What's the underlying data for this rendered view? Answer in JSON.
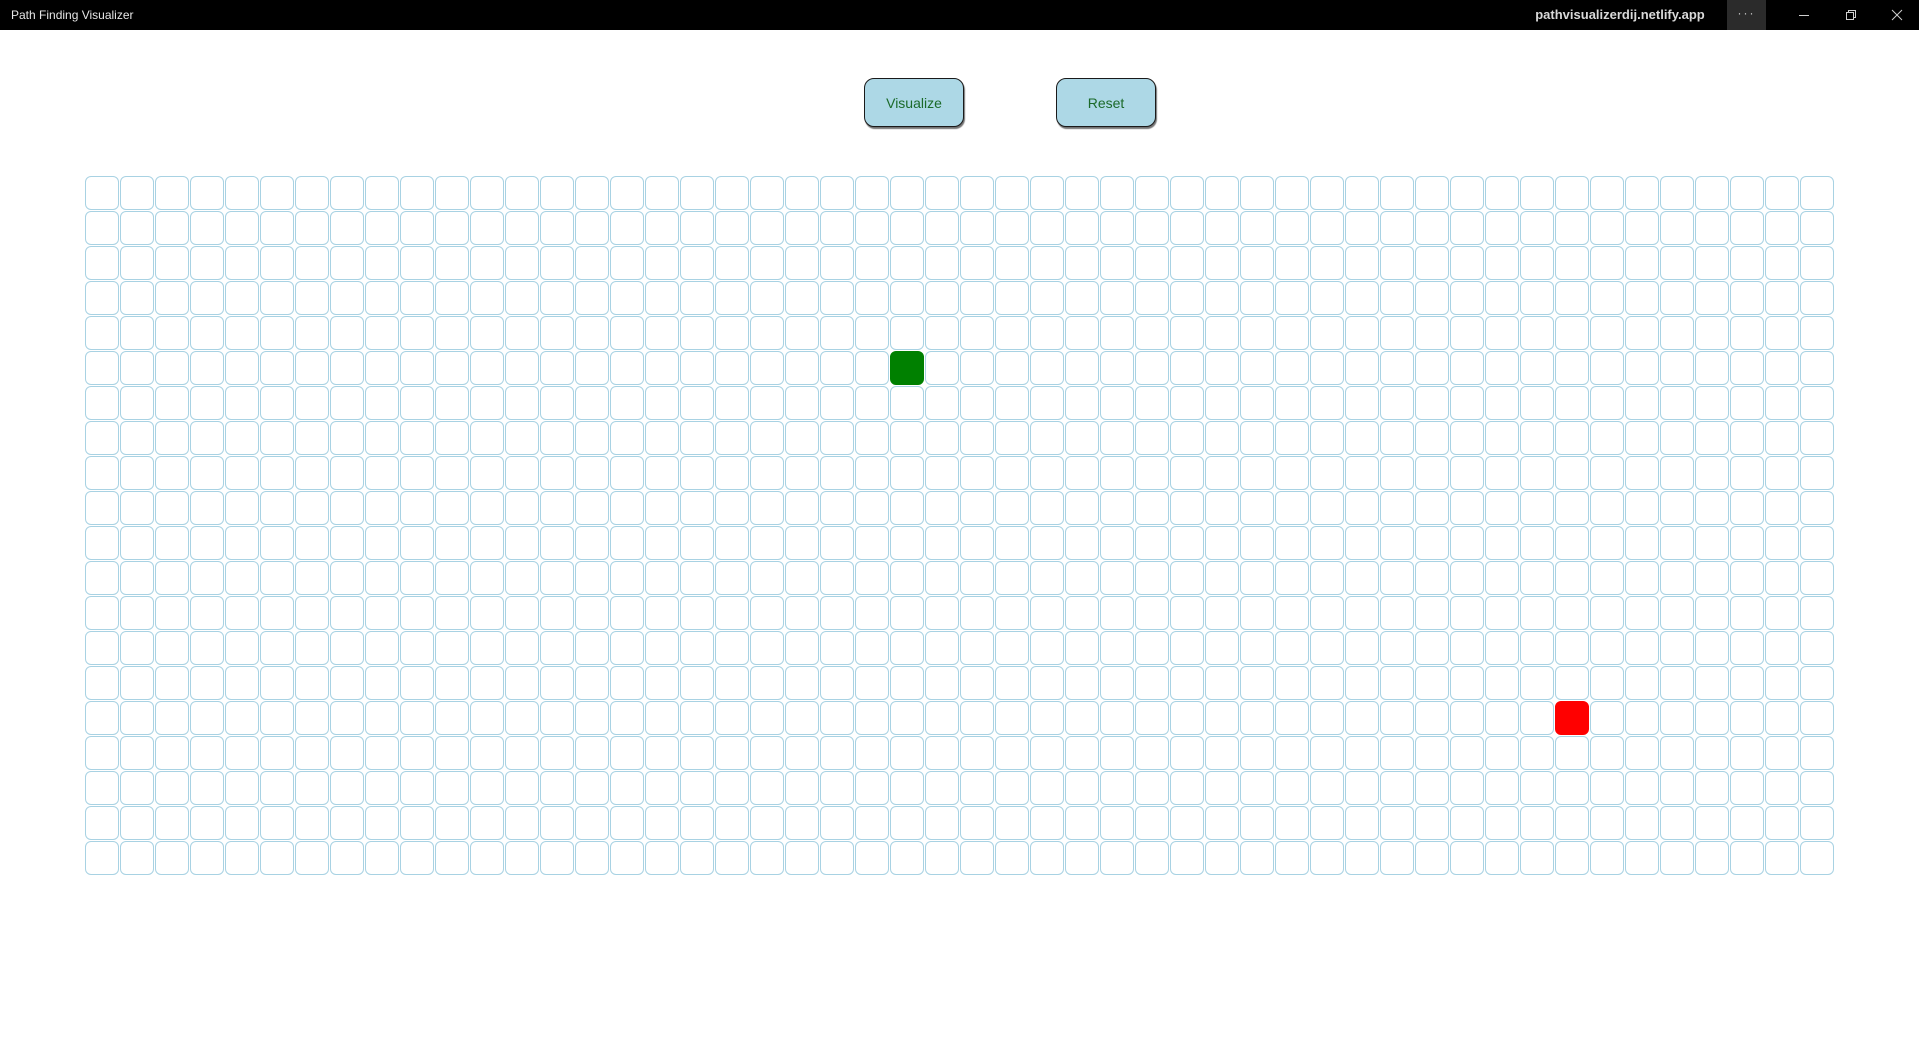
{
  "window": {
    "title": "Path Finding Visualizer",
    "url": "pathvisualizerdij.netlify.app",
    "more_label": "···",
    "icons": [
      "more-icon",
      "minimize-icon",
      "maximize-icon",
      "close-icon"
    ]
  },
  "toolbar": {
    "visualize_label": "Visualize",
    "reset_label": "Reset"
  },
  "grid": {
    "rows": 20,
    "cols": 50,
    "start": {
      "row": 5,
      "col": 23
    },
    "end": {
      "row": 15,
      "col": 42
    }
  },
  "colors": {
    "button_bg": "#add8e6",
    "button_text": "#1b6a2a",
    "cell_border": "#a8d2e3",
    "start_node": "#008000",
    "end_node": "#ff0000",
    "titlebar_bg": "#000000"
  }
}
